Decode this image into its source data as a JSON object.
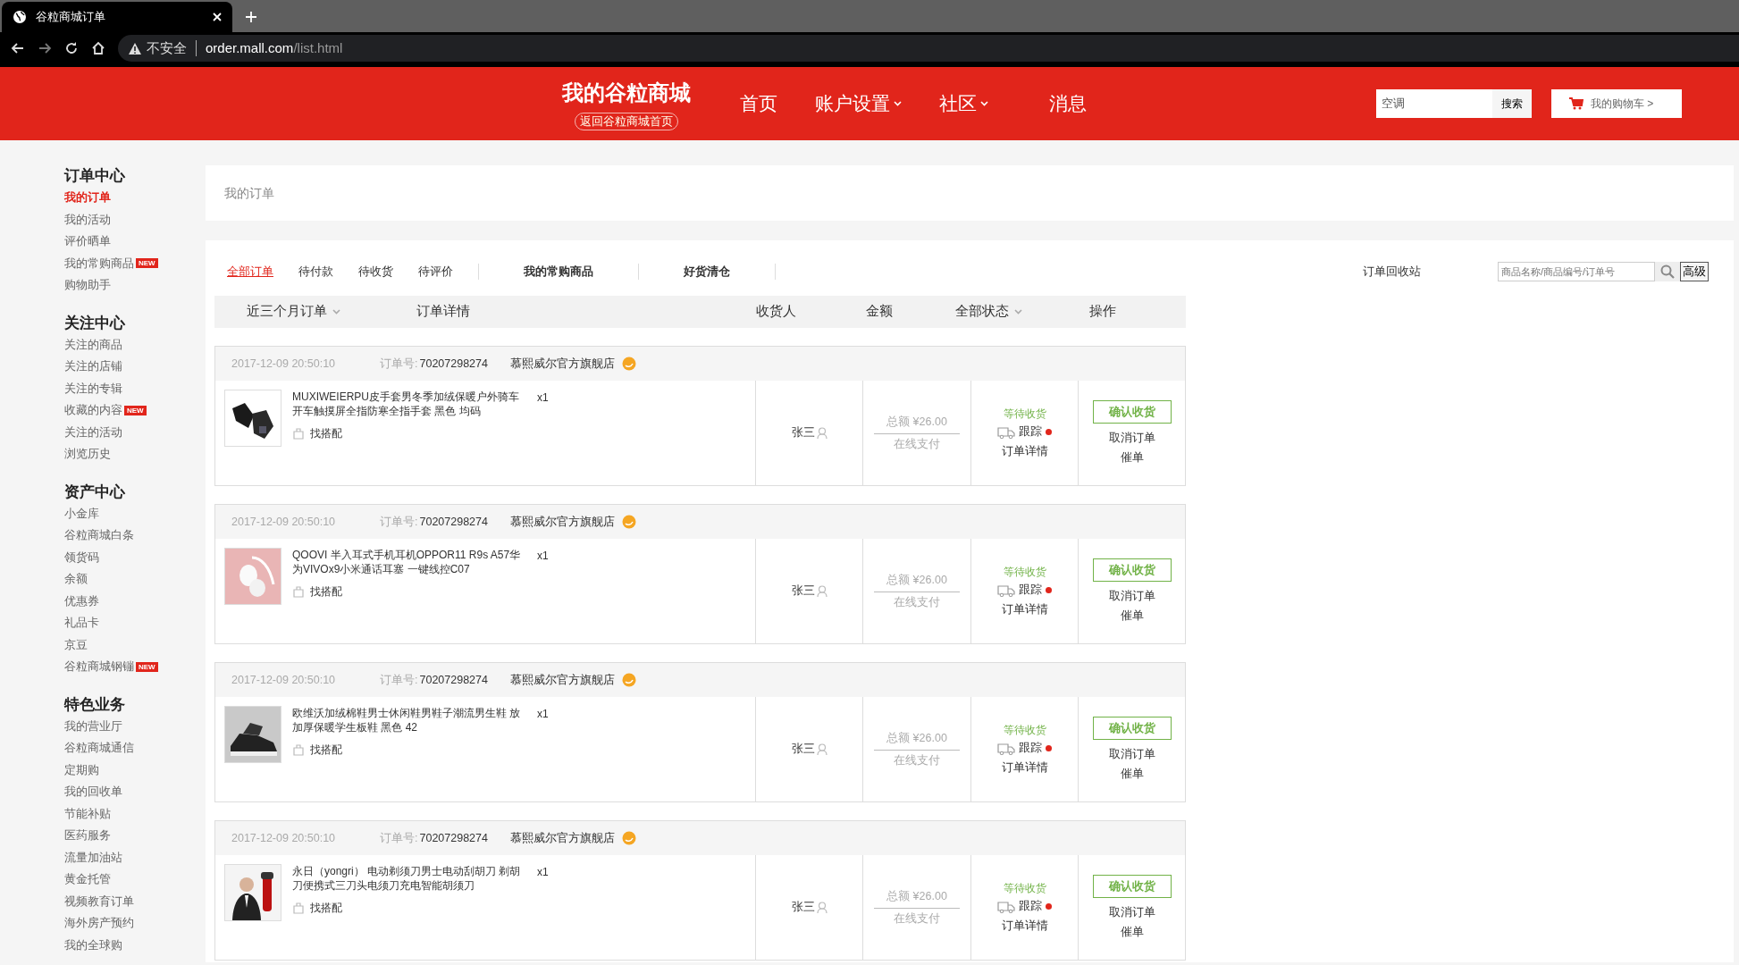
{
  "browser": {
    "tab_title": "谷粒商城订单",
    "security": "不安全",
    "url_host": "order.mall.com",
    "url_path": "/list.html"
  },
  "header": {
    "logo": "我的谷粒商城",
    "home_link": "返回谷粒商城首页",
    "nav": [
      {
        "label": "首页",
        "dropdown": false
      },
      {
        "label": "账户设置",
        "dropdown": true
      },
      {
        "label": "社区",
        "dropdown": true
      },
      {
        "label": "消息",
        "dropdown": false
      }
    ],
    "search": {
      "value": "空调",
      "button": "搜索"
    },
    "cart": "我的购物车 >"
  },
  "sidebar": [
    {
      "title": "订单中心",
      "items": [
        {
          "label": "我的订单",
          "selected": true
        },
        {
          "label": "我的活动",
          "selected": false
        },
        {
          "label": "评价晒单",
          "selected": false
        },
        {
          "label": "我的常购商品",
          "selected": false,
          "badge": "NEW"
        },
        {
          "label": "购物助手",
          "selected": false
        }
      ]
    },
    {
      "title": "关注中心",
      "items": [
        {
          "label": "关注的商品",
          "selected": false
        },
        {
          "label": "关注的店铺",
          "selected": false
        },
        {
          "label": "关注的专辑",
          "selected": false
        },
        {
          "label": "收藏的内容",
          "selected": false,
          "badge": "NEW"
        },
        {
          "label": "关注的活动",
          "selected": false
        },
        {
          "label": "浏览历史",
          "selected": false
        }
      ]
    },
    {
      "title": "资产中心",
      "items": [
        {
          "label": "小金库",
          "selected": false
        },
        {
          "label": "谷粒商城白条",
          "selected": false
        },
        {
          "label": "领货码",
          "selected": false
        },
        {
          "label": "余额",
          "selected": false
        },
        {
          "label": "优惠券",
          "selected": false
        },
        {
          "label": "礼品卡",
          "selected": false
        },
        {
          "label": "京豆",
          "selected": false
        },
        {
          "label": "谷粒商城钢镚",
          "selected": false,
          "badge": "NEW"
        }
      ]
    },
    {
      "title": "特色业务",
      "items": [
        {
          "label": "我的营业厅",
          "selected": false
        },
        {
          "label": "谷粒商城通信",
          "selected": false
        },
        {
          "label": "定期购",
          "selected": false
        },
        {
          "label": "我的回收单",
          "selected": false
        },
        {
          "label": "节能补贴",
          "selected": false
        },
        {
          "label": "医药服务",
          "selected": false
        },
        {
          "label": "流量加油站",
          "selected": false
        },
        {
          "label": "黄金托管",
          "selected": false
        },
        {
          "label": "视频教育订单",
          "selected": false
        },
        {
          "label": "海外房产预约",
          "selected": false
        },
        {
          "label": "我的全球购",
          "selected": false
        }
      ]
    }
  ],
  "breadcrumb": "我的订单",
  "tabs": [
    {
      "label": "全部订单",
      "selected": true,
      "kind": "status"
    },
    {
      "label": "待付款",
      "selected": false,
      "kind": "status"
    },
    {
      "label": "待收货",
      "selected": false,
      "kind": "status"
    },
    {
      "label": "待评价",
      "selected": false,
      "kind": "status"
    },
    {
      "label": "我的常购商品",
      "selected": false,
      "kind": "feature"
    },
    {
      "label": "好货清仓",
      "selected": false,
      "kind": "feature"
    }
  ],
  "recycle_bin": "订单回收站",
  "order_search": {
    "placeholder": "商品名称/商品编号/订单号",
    "advanced": "高级"
  },
  "columns": [
    {
      "label": "近三个月订单",
      "dropdown": true
    },
    {
      "label": "订单详情",
      "dropdown": false
    },
    {
      "label": "收货人",
      "dropdown": false
    },
    {
      "label": "金额",
      "dropdown": false
    },
    {
      "label": "全部状态",
      "dropdown": true
    },
    {
      "label": "操作",
      "dropdown": false
    }
  ],
  "orders": [
    {
      "time": "2017-12-09 20:50:10",
      "order_no_label": "订单号:",
      "order_no": "70207298274",
      "shop": "慕熙威尔官方旗舰店",
      "product": "MUXIWEIERPU皮手套男冬季加绒保暖户外骑车开车触摸屏全指防寒全指手套 黑色 均码",
      "qty": "x1",
      "match": "找搭配",
      "recipient": "张三",
      "total_label": "总额",
      "total": "¥26.00",
      "payment": "在线支付",
      "status": "等待收货",
      "track": "跟踪",
      "detail": "订单详情",
      "confirm": "确认收货",
      "cancel": "取消订单",
      "remind": "催单"
    },
    {
      "time": "2017-12-09 20:50:10",
      "order_no_label": "订单号:",
      "order_no": "70207298274",
      "shop": "慕熙威尔官方旗舰店",
      "product": "QOOVI 半入耳式手机耳机OPPOR11 R9s A57华为VIVOx9小米通话耳塞 一键线控C07",
      "qty": "x1",
      "match": "找搭配",
      "recipient": "张三",
      "total_label": "总额",
      "total": "¥26.00",
      "payment": "在线支付",
      "status": "等待收货",
      "track": "跟踪",
      "detail": "订单详情",
      "confirm": "确认收货",
      "cancel": "取消订单",
      "remind": "催单"
    },
    {
      "time": "2017-12-09 20:50:10",
      "order_no_label": "订单号:",
      "order_no": "70207298274",
      "shop": "慕熙威尔官方旗舰店",
      "product": "欧维沃加绒棉鞋男士休闲鞋男鞋子潮流男生鞋 放加厚保暖学生板鞋 黑色 42",
      "qty": "x1",
      "match": "找搭配",
      "recipient": "张三",
      "total_label": "总额",
      "total": "¥26.00",
      "payment": "在线支付",
      "status": "等待收货",
      "track": "跟踪",
      "detail": "订单详情",
      "confirm": "确认收货",
      "cancel": "取消订单",
      "remind": "催单"
    },
    {
      "time": "2017-12-09 20:50:10",
      "order_no_label": "订单号:",
      "order_no": "70207298274",
      "shop": "慕熙威尔官方旗舰店",
      "product": "永日（yongri） 电动剃须刀男士电动刮胡刀 剃胡刀便携式三刀头电须刀充电智能胡须刀",
      "qty": "x1",
      "match": "找搭配",
      "recipient": "张三",
      "total_label": "总额",
      "total": "¥26.00",
      "payment": "在线支付",
      "status": "等待收货",
      "track": "跟踪",
      "detail": "订单详情",
      "confirm": "确认收货",
      "cancel": "取消订单",
      "remind": "催单"
    }
  ]
}
